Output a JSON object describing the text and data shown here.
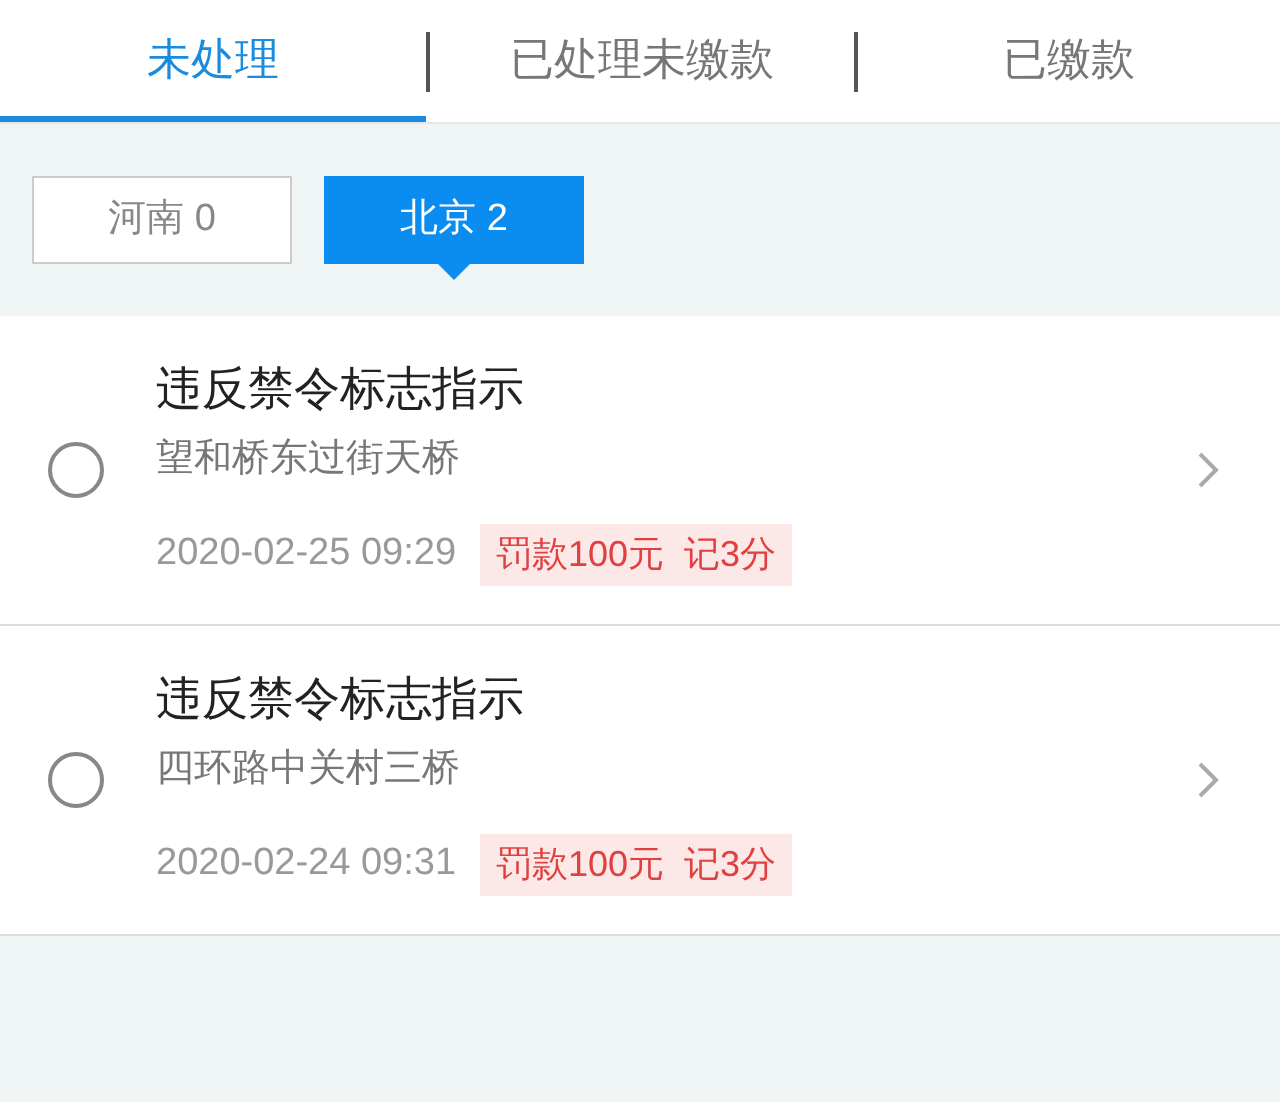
{
  "tabs": [
    {
      "label": "未处理",
      "selected": true
    },
    {
      "label": "已处理未缴款",
      "selected": false
    },
    {
      "label": "已缴款",
      "selected": false
    }
  ],
  "regions": [
    {
      "label": "河南 0",
      "selected": false
    },
    {
      "label": "北京 2",
      "selected": true
    }
  ],
  "violations": [
    {
      "title": "违反禁令标志指示",
      "location": "望和桥东过街天桥",
      "time": "2020-02-25 09:29",
      "penalty": "罚款100元  记3分",
      "checked": false
    },
    {
      "title": "违反禁令标志指示",
      "location": "四环路中关村三桥",
      "time": "2020-02-24 09:31",
      "penalty": "罚款100元  记3分",
      "checked": false
    }
  ]
}
